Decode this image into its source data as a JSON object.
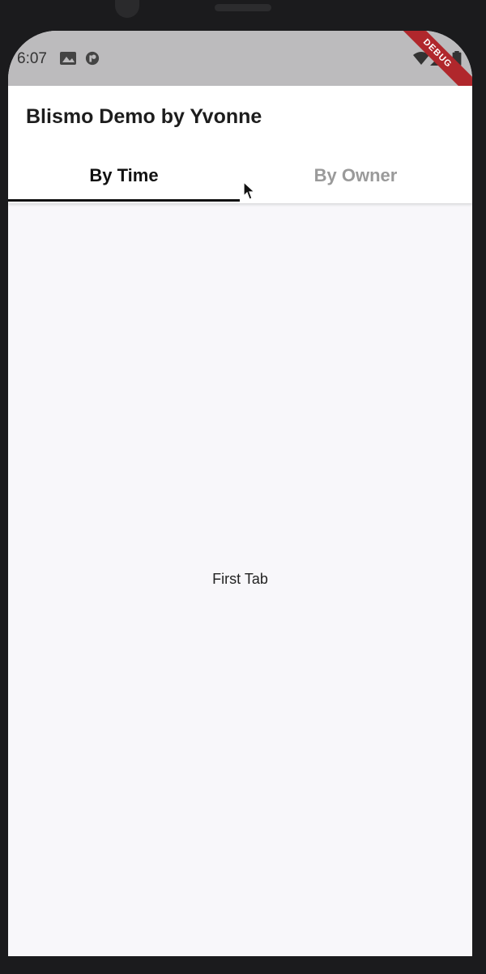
{
  "status_bar": {
    "time": "6:07",
    "debug_label": "DEBUG",
    "icons": [
      "image-notification-icon",
      "app-notification-icon",
      "wifi-icon",
      "signal-icon",
      "battery-icon"
    ]
  },
  "app_bar": {
    "title": "Blismo Demo by Yvonne"
  },
  "tabs": [
    {
      "label": "By Time",
      "active": true
    },
    {
      "label": "By Owner",
      "active": false
    }
  ],
  "content": {
    "text": "First Tab"
  },
  "colors": {
    "status_bar_bg": "#bcbbbd",
    "app_bar_bg": "#ffffff",
    "screen_bg": "#f8f7fa",
    "active_tab": "#111111",
    "inactive_tab": "#9a9a9a",
    "debug_ribbon": "#b0272c"
  }
}
